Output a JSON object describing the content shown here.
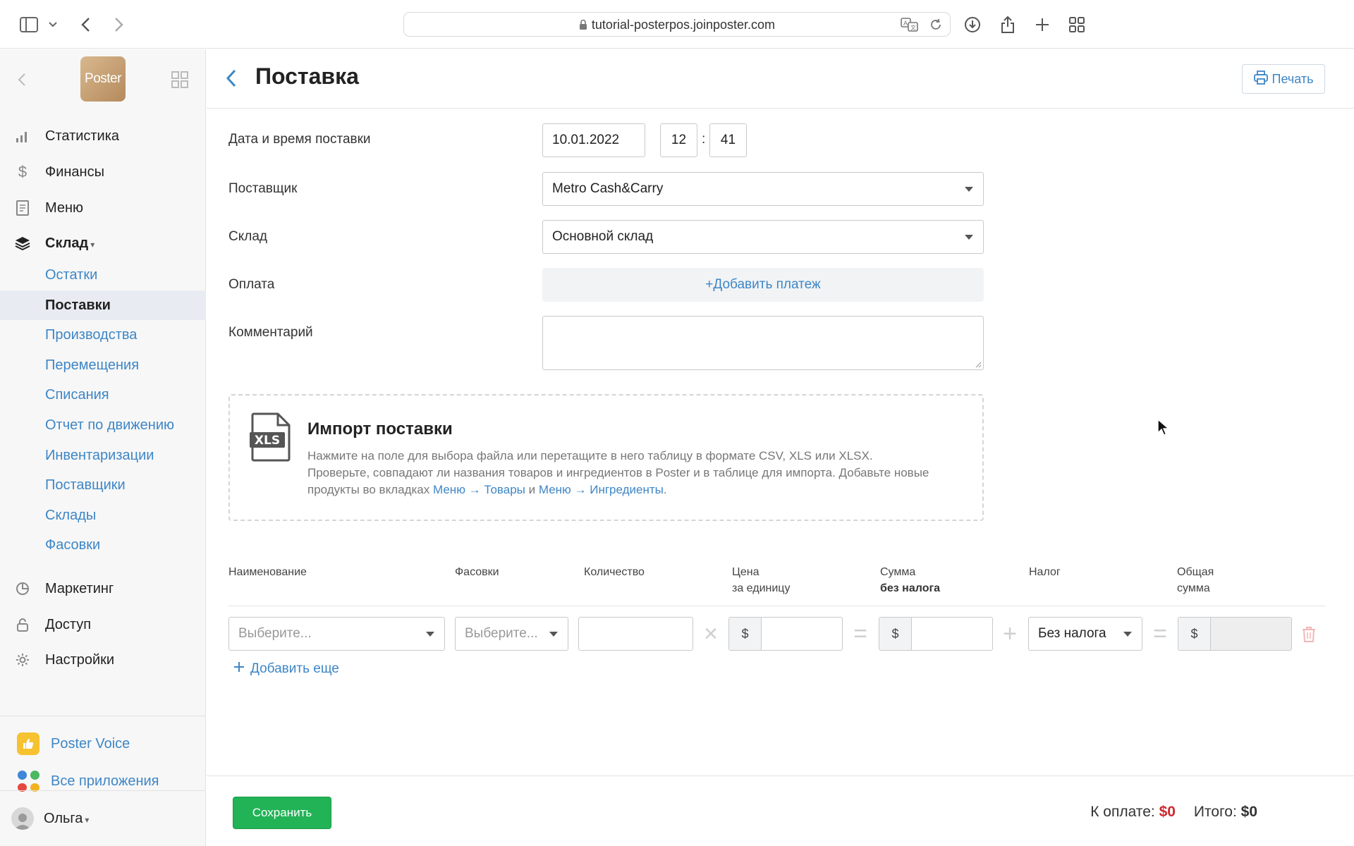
{
  "browser": {
    "url": "tutorial-posterpos.joinposter.com"
  },
  "sidebar": {
    "logo_text": "Poster",
    "nav": [
      {
        "label": "Статистика",
        "icon": "bar-chart-icon"
      },
      {
        "label": "Финансы",
        "icon": "dollar-icon"
      },
      {
        "label": "Меню",
        "icon": "document-icon"
      },
      {
        "label": "Склад",
        "icon": "layers-icon"
      }
    ],
    "warehouse_caret": "▾",
    "sub_items": [
      {
        "label": "Остатки"
      },
      {
        "label": "Поставки",
        "active": true
      },
      {
        "label": "Производства"
      },
      {
        "label": "Перемещения"
      },
      {
        "label": "Списания"
      },
      {
        "label": "Отчет по движению"
      },
      {
        "label": "Инвентаризации"
      },
      {
        "label": "Поставщики"
      },
      {
        "label": "Склады"
      },
      {
        "label": "Фасовки"
      }
    ],
    "nav_bottom": [
      {
        "label": "Маркетинг",
        "icon": "pie-icon"
      },
      {
        "label": "Доступ",
        "icon": "lock-icon"
      },
      {
        "label": "Настройки",
        "icon": "gear-icon"
      }
    ],
    "apps": [
      {
        "label": "Poster Voice",
        "icon": "thumbs-up-icon"
      },
      {
        "label": "Все приложения",
        "icon": "apps-grid-icon"
      }
    ],
    "user": {
      "name": "Ольга",
      "caret": "▾"
    }
  },
  "header": {
    "title": "Поставка",
    "print_label": "Печать"
  },
  "form": {
    "date_label": "Дата и время поставки",
    "date_value": "10.01.2022",
    "hour_value": "12",
    "time_sep": ":",
    "minute_value": "41",
    "supplier_label": "Поставщик",
    "supplier_value": "Metro Cash&Carry",
    "warehouse_label": "Склад",
    "warehouse_value": "Основной склад",
    "payment_label": "Оплата",
    "add_payment_label": "+Добавить платеж",
    "comment_label": "Комментарий",
    "comment_value": ""
  },
  "import": {
    "icon_text": "XLS",
    "title": "Импорт поставки",
    "text_1": "Нажмите на поле для выбора файла или перетащите в него таблицу в формате CSV, XLS или XLSX.",
    "text_2": "Проверьте, совпадают ли названия товаров и ингредиентов в Poster и в таблице для импорта. Добавьте новые продукты во вкладках",
    "link_1": "Меню → Товары",
    "and": "и",
    "link_2": "Меню → Ингредиенты",
    "end": "."
  },
  "table": {
    "headers": {
      "name": "Наименование",
      "packaging": "Фасовки",
      "quantity": "Количество",
      "price_1": "Цена",
      "price_2": "за единицу",
      "sum_1": "Сумма",
      "sum_2": "без налога",
      "tax": "Налог",
      "total_1": "Общая",
      "total_2": "сумма"
    },
    "row": {
      "name_placeholder": "Выберите...",
      "packaging_placeholder": "Выберите...",
      "quantity": "",
      "currency": "$",
      "tax_value": "Без налога",
      "op_times": "×",
      "op_equals": "=",
      "op_plus": "+"
    },
    "add_more_label": "Добавить еще"
  },
  "footer": {
    "save_label": "Сохранить",
    "to_pay_label": "К оплате:",
    "to_pay_value": "$0",
    "total_label": "Итого:",
    "total_value": "$0"
  }
}
